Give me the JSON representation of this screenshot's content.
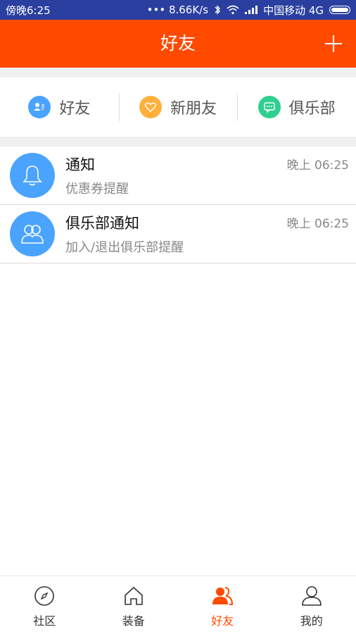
{
  "status_bar": {
    "time": "傍晚6:25",
    "speed": "••• 8.66K/s",
    "carrier": "中国移动 4G"
  },
  "header": {
    "title": "好友",
    "add_icon": "plus-icon"
  },
  "shortcuts": [
    {
      "label": "好友",
      "icon": "contact-card-icon",
      "color": "#4aa3ff"
    },
    {
      "label": "新朋友",
      "icon": "heart-icon",
      "color": "#ffb03b"
    },
    {
      "label": "俱乐部",
      "icon": "chat-bubble-icon",
      "color": "#2ecf8f"
    }
  ],
  "list": [
    {
      "title": "通知",
      "subtitle": "优惠券提醒",
      "time": "晚上 06:25",
      "icon": "bell-icon"
    },
    {
      "title": "俱乐部通知",
      "subtitle": "加入/退出俱乐部提醒",
      "time": "晚上 06:25",
      "icon": "group-icon"
    }
  ],
  "tabbar": [
    {
      "label": "社区",
      "icon": "compass-icon"
    },
    {
      "label": "装备",
      "icon": "home-icon"
    },
    {
      "label": "好友",
      "icon": "friends-icon",
      "active": true
    },
    {
      "label": "我的",
      "icon": "user-icon"
    }
  ],
  "colors": {
    "accent": "#ff4a00",
    "status_bar": "#2a3f9f",
    "avatar_blue": "#4aa3ff"
  }
}
